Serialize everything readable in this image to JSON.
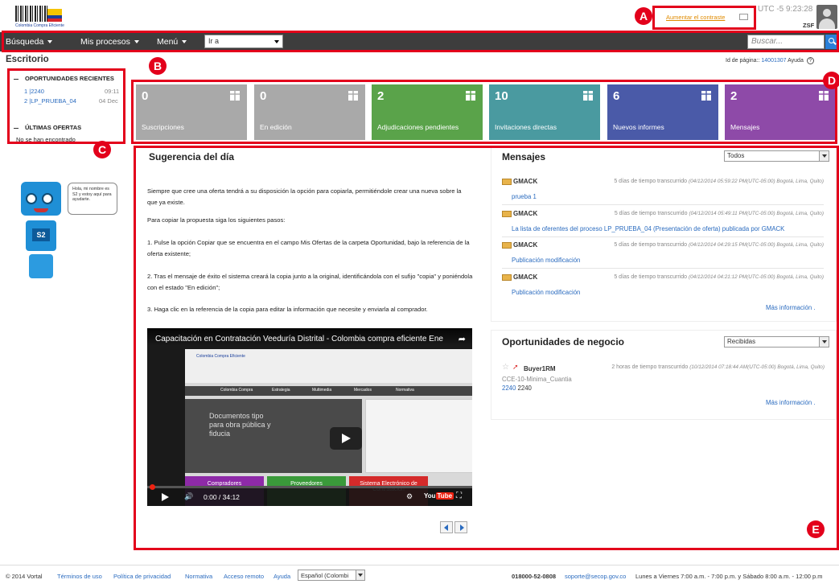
{
  "header": {
    "logo_text": "Colombia Compra Eficiente",
    "contrast_link": "Aumentar el contraste",
    "clock": "UTC -5 9:23:28",
    "user_code": "ZSF"
  },
  "nav": {
    "items": [
      {
        "label": "Búsqueda"
      },
      {
        "label": "Mis procesos"
      },
      {
        "label": "Menú"
      }
    ],
    "goto_label": "Ir a",
    "search_placeholder": "Buscar..."
  },
  "page": {
    "title": "Escritorio",
    "id_label": "Id de página::",
    "id_value": "14001307",
    "help_label": "Ayuda"
  },
  "sidebar": {
    "recent_title": "OPORTUNIDADES RECIENTES",
    "recent": [
      {
        "label": "1 |2240",
        "meta": "09:11"
      },
      {
        "label": "2 |LP_PRUEBA_04",
        "meta": "04 Dec"
      }
    ],
    "offers_title": "ÚLTIMAS OFERTAS",
    "offers_empty": "No se han encontrado",
    "mascot_bubble": "Hola, mi nombre es S2 y estoy aquí para ayudarte.",
    "mascot_badge": "S2"
  },
  "tiles": [
    {
      "count": "0",
      "label": "Suscripciones",
      "color": "#a9a9a9"
    },
    {
      "count": "0",
      "label": "En edición",
      "color": "#a9a9a9"
    },
    {
      "count": "2",
      "label": "Adjudicaciones pendientes",
      "color": "#5aa34a"
    },
    {
      "count": "10",
      "label": "Invitaciones directas",
      "color": "#4a9aa0"
    },
    {
      "count": "6",
      "label": "Nuevos informes",
      "color": "#4a5aa8"
    },
    {
      "count": "2",
      "label": "Mensajes",
      "color": "#8e4aa8"
    }
  ],
  "suggestion": {
    "title": "Sugerencia del día",
    "p1": "Siempre que cree una oferta tendrá a su disposición la opción para copiarla, permitiéndole crear una nueva sobre la que ya existe.",
    "p2": "Para copiar la propuesta siga los siguientes pasos:",
    "p3": "1. Pulse la opción Copiar que se encuentra en el campo Mis Ofertas de la carpeta Oportunidad, bajo la referencia de la oferta existente;",
    "p4": "2. Tras el mensaje de éxito el sistema creará la copia junto a la original, identificándola con el sufijo \"copia\" y poniéndola con el estado \"En edición\";",
    "p5": "3. Haga clic en la referencia de la copia para editar la información que necesite y enviarla al comprador.",
    "video": {
      "title": "Capacitación en Contratación Veeduría Distrital - Colombia compra eficiente Ene",
      "time": "0:00 / 34:12",
      "inner_logo": "Colombia Compra Eficiente",
      "inner_nav": [
        "Colombia Compra",
        "Estrategia",
        "Multimedia",
        "Mercados",
        "Normativa"
      ],
      "inner_dark_text": "Documentos tipo para obra pública y fiducia",
      "inner_tiles": [
        "Compradores",
        "Proveedores",
        "Sistema Electrónico de Contratación"
      ]
    }
  },
  "messages": {
    "title": "Mensajes",
    "filter": "Todos",
    "items": [
      {
        "sender": "GMACK",
        "time": "5 días de tiempo transcurrido",
        "stamp": "(04/12/2014 05:59:22 PM(UTC-05:00) Bogotá, Lima, Quito)",
        "subject": "prueba 1"
      },
      {
        "sender": "GMACK",
        "time": "5 días de tiempo transcurrido",
        "stamp": "(04/12/2014 05:49:11 PM(UTC-05:00) Bogotá, Lima, Quito)",
        "subject": "La lista de oferentes del proceso LP_PRUEBA_04 (Presentación de oferta) publicada por GMACK"
      },
      {
        "sender": "GMACK",
        "time": "5 días de tiempo transcurrido",
        "stamp": "(04/12/2014 04:29:15 PM(UTC-05:00) Bogotá, Lima, Quito)",
        "subject": "Publicación modificación"
      },
      {
        "sender": "GMACK",
        "time": "5 días de tiempo transcurrido",
        "stamp": "(04/12/2014 04:21:12 PM(UTC-05:00) Bogotá, Lima, Quito)",
        "subject": "Publicación modificación"
      }
    ],
    "more": "Más información ."
  },
  "opportunities": {
    "title": "Oportunidades de negocio",
    "filter": "Recibidas",
    "item": {
      "buyer": "Buyer1RM",
      "time": "2 horas de tiempo transcurrido",
      "stamp": "(10/12/2014 07:18:44 AM(UTC-05:00) Bogotá, Lima, Quito)",
      "code": "CCE-10-Minima_Cuantia",
      "ref": "2240",
      "ref_text": "2240"
    },
    "more": "Más información ."
  },
  "footer": {
    "copyright": "© 2014 Vortal",
    "links": [
      "Términos de uso",
      "Política de privacidad",
      "Normativa",
      "Acceso remoto",
      "Ayuda"
    ],
    "language": "Español (Colombi",
    "phone": "018000-52-0808",
    "email": "soporte@secop.gov.co",
    "hours": "Lunes a Viernes 7:00 a.m. - 7:00 p.m. y Sábado 8:00 a.m. - 12:00 p.m"
  },
  "annotations": [
    "A",
    "B",
    "C",
    "D",
    "E"
  ],
  "colors": {
    "annotation": "#e3001b",
    "link": "#2a6bbf",
    "navbar": "#3d3d3d"
  }
}
